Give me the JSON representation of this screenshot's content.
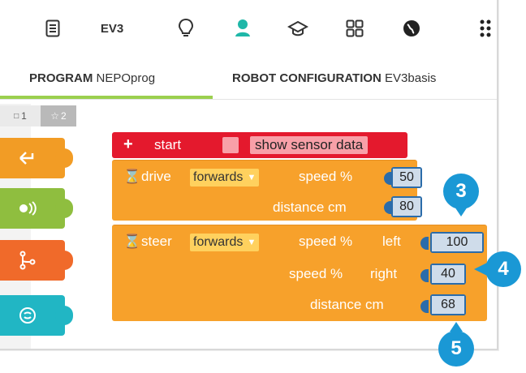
{
  "toolbar": {
    "ev3_label": "EV3",
    "icons": [
      "list-icon",
      "ev3-icon",
      "lightbulb-icon",
      "user-icon",
      "graduation-cap-icon",
      "grid-icon",
      "globe-icon",
      "more-icon"
    ]
  },
  "tabs": {
    "program": {
      "label": "PROGRAM",
      "name": "NEPOprog"
    },
    "robot": {
      "label": "ROBOT CONFIGURATION",
      "name": "EV3basis"
    }
  },
  "levels": {
    "one": "1",
    "two": "2"
  },
  "colors": {
    "accent_green": "#9bd04f",
    "start_red": "#e4192d",
    "action_orange": "#f7a12b",
    "badge_blue": "#1a98d5"
  },
  "blocks": {
    "start": {
      "label": "start",
      "plus": "+",
      "sensor": "show sensor data"
    },
    "drive": {
      "label": "drive",
      "direction": "forwards",
      "speed_label": "speed %",
      "speed": "50",
      "distance_label": "distance cm",
      "distance": "80"
    },
    "steer": {
      "label": "steer",
      "direction": "forwards",
      "speed_left_label": "speed %",
      "left_label": "left",
      "speed_left": "100",
      "speed_right_label": "speed %",
      "right_label": "right",
      "speed_right": "40",
      "distance_label": "distance cm",
      "distance": "68"
    }
  },
  "badges": {
    "b3": "3",
    "b4": "4",
    "b5": "5"
  }
}
